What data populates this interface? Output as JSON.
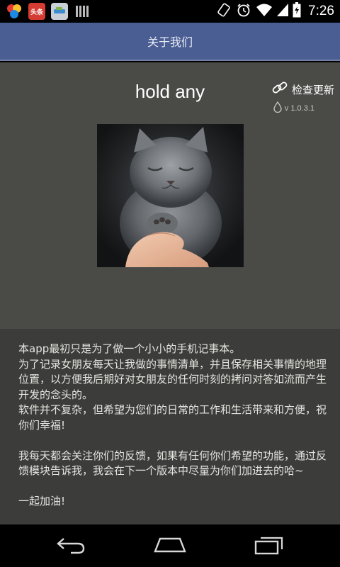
{
  "status_bar": {
    "time": "7:26",
    "notification_icons": [
      "color-dots-icon",
      "toutiao-icon",
      "app-icon",
      "barcode-icon"
    ],
    "toutiao_label": "头条",
    "system_icons": [
      "rotate-icon",
      "alarm-icon",
      "wifi-icon",
      "signal-icon",
      "battery-icon"
    ]
  },
  "header": {
    "title": "关于我们"
  },
  "about": {
    "app_name": "hold any",
    "update_label": "检查更新",
    "version": "v 1.0.3.1"
  },
  "description": {
    "paragraphs": [
      "本app最初只是为了做一个小小的手机记事本。",
      "为了记录女朋友每天让我做的事情清单，并且保存相关事情的地理位置，以方便我后期好对女朋友的任何时刻的拷问对答如流而产生开发的念头的。",
      "软件并不复杂，但希望为您们的日常的工作和生活带来和方便，祝你们幸福!",
      "我每天都会关注你们的反馈，如果有任何你们希望的功能，通过反馈模块告诉我，我会在下一个版本中尽量为你们加进去的哈~",
      "一起加油!"
    ]
  },
  "nav_bar": {
    "buttons": [
      "back-icon",
      "home-icon",
      "recents-icon"
    ]
  },
  "colors": {
    "header_bg": "#4b5e93",
    "main_bg": "#4a4b47",
    "description_bg": "#3c3d3a"
  }
}
